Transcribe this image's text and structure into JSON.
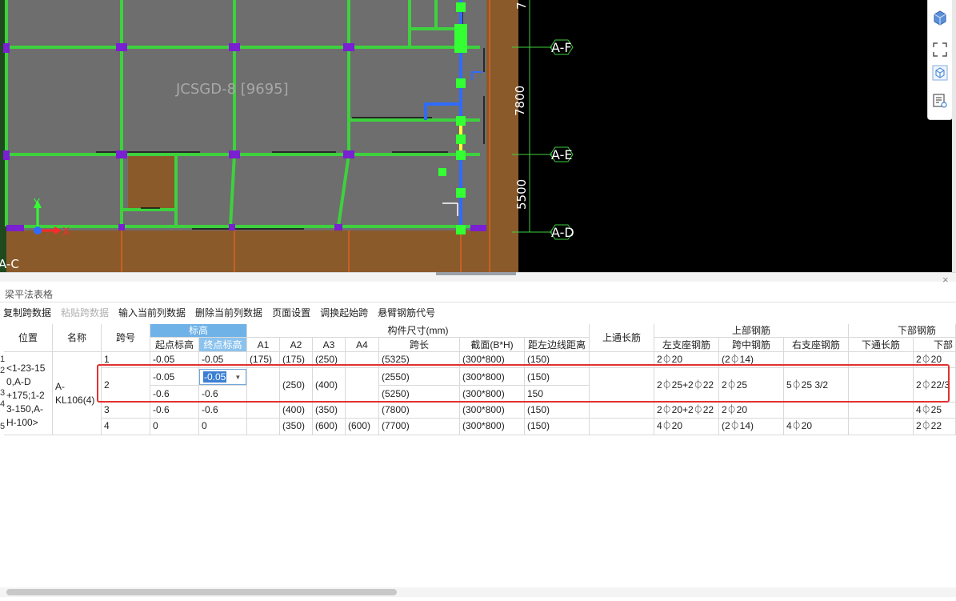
{
  "cad": {
    "component_label": "JCSGD-8 [9695]",
    "axis_labels": [
      "A-F",
      "A-E",
      "A-D",
      "A-C"
    ],
    "dimensions": [
      "7800",
      "5500",
      "7"
    ],
    "axis_x": "X",
    "axis_y": "Y",
    "colors": {
      "background": "#000000",
      "slab": "#6e6e6e",
      "beam": "#3ed13e",
      "column": "#7a1fd1",
      "wall": "#8b5a2b",
      "selected": "#2f6bff",
      "highlight": "#ffff33"
    }
  },
  "view_tools": {
    "icons": [
      "3d-cube-icon",
      "fullscreen-icon",
      "view-cube-icon",
      "list-settings-icon"
    ]
  },
  "panel": {
    "title": "梁平法表格",
    "close_glyph": "×",
    "toolbar": [
      {
        "label": "复制跨数据",
        "enabled": true
      },
      {
        "label": "粘贴跨数据",
        "enabled": false
      },
      {
        "label": "输入当前列数据",
        "enabled": true
      },
      {
        "label": "删除当前列数据",
        "enabled": true
      },
      {
        "label": "页面设置",
        "enabled": true
      },
      {
        "label": "调换起始跨",
        "enabled": true
      },
      {
        "label": "悬臂钢筋代号",
        "enabled": true
      }
    ]
  },
  "table": {
    "headers": {
      "position": "位置",
      "name": "名称",
      "span": "跨号",
      "elevation": "标高",
      "start_elev": "起点标高",
      "end_elev": "终点标高",
      "dims": "构件尺寸(mm)",
      "a1": "A1",
      "a2": "A2",
      "a3": "A3",
      "a4": "A4",
      "span_len": "跨长",
      "section": "截面(B*H)",
      "left_edge": "距左边线距离",
      "top_through": "上通长筋",
      "top_rebar": "上部钢筋",
      "left_support": "左支座钢筋",
      "mid_span": "跨中钢筋",
      "right_support": "右支座钢筋",
      "bottom_rebar": "下部钢筋",
      "bottom_through": "下通长筋",
      "bottom_partial": "下部"
    },
    "row_numbers": [
      "1",
      "2",
      "3",
      "4",
      "5"
    ],
    "position_value": "<1-23-150,A-D+175;1-23-150,A-H-100>",
    "position_lines": [
      "<1-23-15",
      "0,A-D",
      "+175;1-2",
      "3-150,A-",
      "H-100>"
    ],
    "name_lines": [
      "A-",
      "KL106(4)"
    ],
    "rows": [
      {
        "span": "1",
        "start": "-0.05",
        "end": "-0.05",
        "a1": "(175)",
        "a2": "(175)",
        "a3": "(250)",
        "a4": "",
        "len": "(5325)",
        "sec": "(300*800)",
        "dist": "(150)",
        "top": "",
        "left": "2⏀20",
        "mid": "(2⏀14)",
        "right": "",
        "bot": "",
        "botp": "2⏀20"
      },
      {
        "span": "2",
        "start": "-0.05",
        "end": "-0.05",
        "a1": "",
        "a2": "(250)",
        "a3": "(400)",
        "a4": "",
        "len": "(2550)",
        "sec": "(300*800)",
        "dist": "(150)",
        "top": "",
        "left": "2⏀25+2⏀22",
        "mid": "2⏀25",
        "right": "5⏀25 3/2",
        "bot": "",
        "botp": "2⏀22/3"
      },
      {
        "span": "",
        "start": "-0.6",
        "end": "-0.6",
        "a1": "",
        "a2": "",
        "a3": "",
        "a4": "",
        "len": "(5250)",
        "sec": "(300*800)",
        "dist": "150",
        "top": "",
        "left": "",
        "mid": "",
        "right": "",
        "bot": "",
        "botp": ""
      },
      {
        "span": "3",
        "start": "-0.6",
        "end": "-0.6",
        "a1": "",
        "a2": "(400)",
        "a3": "(350)",
        "a4": "",
        "len": "(7800)",
        "sec": "(300*800)",
        "dist": "(150)",
        "top": "",
        "left": "2⏀20+2⏀22",
        "mid": "2⏀20",
        "right": "",
        "bot": "",
        "botp": "4⏀25"
      },
      {
        "span": "4",
        "start": "0",
        "end": "0",
        "a1": "",
        "a2": "(350)",
        "a3": "(600)",
        "a4": "(600)",
        "len": "(7700)",
        "sec": "(300*800)",
        "dist": "(150)",
        "top": "",
        "left": "4⏀20",
        "mid": "(2⏀14)",
        "right": "4⏀20",
        "bot": "",
        "botp": "2⏀22"
      }
    ],
    "editing_value": "-0.05"
  }
}
